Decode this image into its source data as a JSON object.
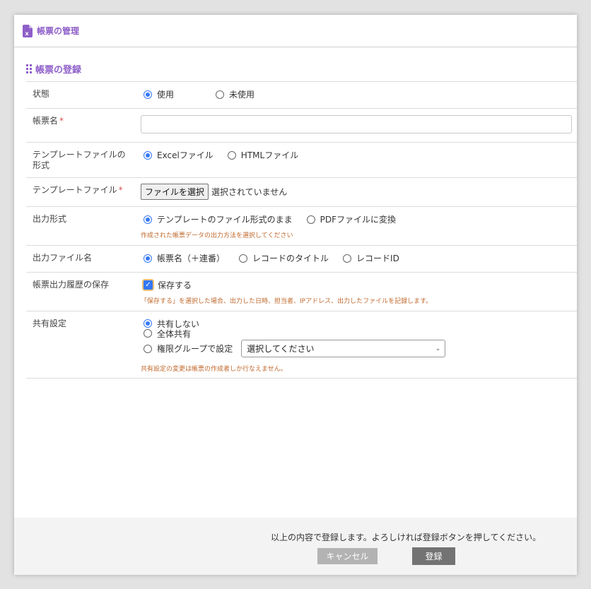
{
  "header": {
    "title": "帳票の管理",
    "icon": "excel-file-icon"
  },
  "section": {
    "title": "帳票の登録",
    "icon": "grid-dots-icon"
  },
  "form": {
    "status": {
      "label": "状態",
      "options": [
        "使用",
        "未使用"
      ],
      "selected": "使用"
    },
    "name": {
      "label": "帳票名",
      "required_mark": "*",
      "value": ""
    },
    "template_format": {
      "label": "テンプレートファイルの形式",
      "options": [
        "Excelファイル",
        "HTMLファイル"
      ],
      "selected": "Excelファイル"
    },
    "template_file": {
      "label": "テンプレートファイル",
      "required_mark": "*",
      "button": "ファイルを選択",
      "status": "選択されていません"
    },
    "output_format": {
      "label": "出力形式",
      "options": [
        "テンプレートのファイル形式のまま",
        "PDFファイルに変換"
      ],
      "selected": "テンプレートのファイル形式のまま",
      "hint": "作成された帳票データの出力方法を選択してください"
    },
    "output_filename": {
      "label": "出力ファイル名",
      "options": [
        "帳票名（＋連番）",
        "レコードのタイトル",
        "レコードID"
      ],
      "selected": "帳票名（＋連番）"
    },
    "history": {
      "label": "帳票出力履歴の保存",
      "checkbox_label": "保存する",
      "checked": true,
      "hint": "「保存する」を選択した場合、出力した日時、担当者、IPアドレス、出力したファイルを記録します。"
    },
    "sharing": {
      "label": "共有設定",
      "options": [
        "共有しない",
        "全体共有",
        "権限グループで設定"
      ],
      "selected": "共有しない",
      "select_placeholder": "選択してください",
      "hint": "共有設定の変更は帳票の作成者しか行なえません。"
    }
  },
  "footer": {
    "message": "以上の内容で登録します。よろしければ登録ボタンを押してください。",
    "cancel": "キャンセル",
    "submit": "登録"
  },
  "colors": {
    "accent": "#8e5fc9",
    "radio": "#3478f6",
    "hint": "#c0692e",
    "required": "#d9534f"
  }
}
